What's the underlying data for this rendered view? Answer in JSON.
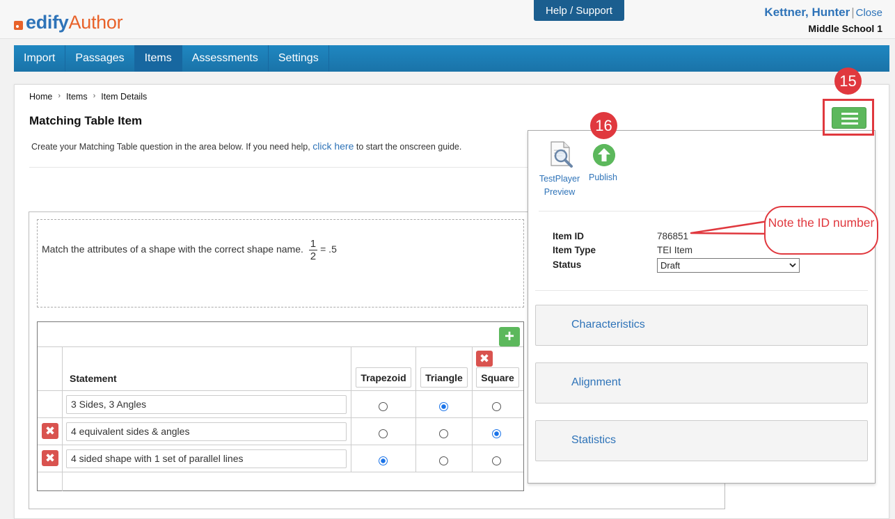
{
  "header": {
    "logo_edify": "edify",
    "logo_author": "Author",
    "help_label": "Help / Support",
    "user_name": "Kettner, Hunter",
    "separator": "|",
    "close_label": "Close",
    "school": "Middle School 1"
  },
  "nav": {
    "items": [
      "Import",
      "Passages",
      "Items",
      "Assessments",
      "Settings"
    ],
    "active": "Items"
  },
  "breadcrumb": {
    "home": "Home",
    "items": "Items",
    "current": "Item Details",
    "sep": "›"
  },
  "page": {
    "title": "Matching Table Item",
    "intro_before": "Create your Matching Table question in the area below. If you need help,",
    "intro_link": "click here",
    "intro_after": "to start the onscreen guide."
  },
  "question": {
    "text": "Match the attributes of a shape with the correct shape name.",
    "frac_num": "1",
    "frac_den": "2",
    "frac_suffix": "= .5"
  },
  "table": {
    "add_column_symbol": "+",
    "statement_header": "Statement",
    "columns": [
      "Trapezoid",
      "Triangle",
      "Square"
    ],
    "delete_symbol": "✖",
    "rows": [
      {
        "statement": "3 Sides, 3 Angles",
        "selected": "Triangle",
        "deletable": false
      },
      {
        "statement": "4 equivalent sides & angles",
        "selected": "Square",
        "deletable": true
      },
      {
        "statement": "4 sided shape with 1 set of parallel lines",
        "selected": "Trapezoid",
        "deletable": true
      }
    ]
  },
  "panel": {
    "testplayer_label": "TestPlayer Preview",
    "publish_label": "Publish",
    "item_id_label": "Item ID",
    "item_id_value": "786851",
    "item_type_label": "Item Type",
    "item_type_value": "TEI Item",
    "status_label": "Status",
    "status_value": "Draft",
    "sections": [
      "Characteristics",
      "Alignment",
      "Statistics"
    ]
  },
  "annotations": {
    "badge_15": "15",
    "badge_16": "16",
    "callout_text": "Note the ID number",
    "color": "#e0383e"
  },
  "icons": {
    "menu": "hamburger-icon",
    "testplayer": "magnifier-document-icon",
    "publish": "upload-arrow-icon"
  },
  "colors": {
    "brand_blue": "#2e73b8",
    "brand_orange": "#e8622a",
    "nav_bg": "#1f87c1",
    "green": "#5cb85c",
    "red": "#d9534f"
  }
}
